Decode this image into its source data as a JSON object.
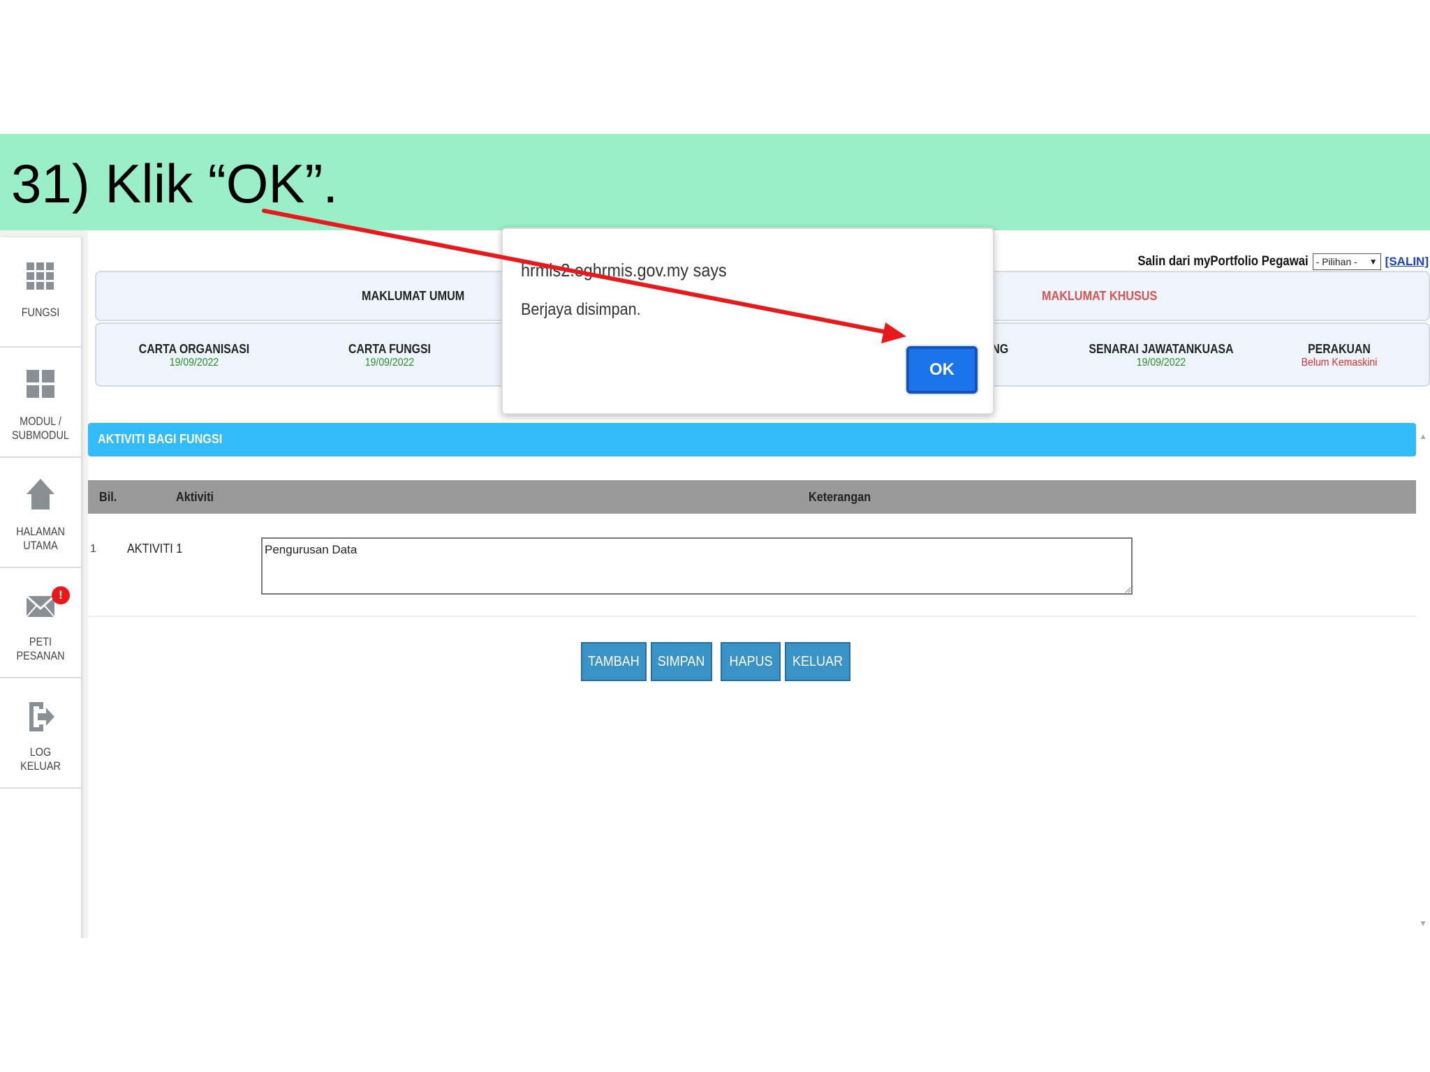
{
  "banner": {
    "instruction": "31) Klik “OK”."
  },
  "sidebar": {
    "items": [
      {
        "label": "FUNGSI",
        "icon": "grid-icon"
      },
      {
        "label": "MODUL /\nSUBMODUL",
        "icon": "modules-icon"
      },
      {
        "label": "HALAMAN\nUTAMA",
        "icon": "home-icon"
      },
      {
        "label": "PETI\nPESANAN",
        "icon": "mail-icon",
        "badge": "!"
      },
      {
        "label": "LOG\nKELUAR",
        "icon": "logout-icon"
      }
    ]
  },
  "copy": {
    "label": "Salin dari myPortfolio Pegawai",
    "select_value": "- Pilihan -",
    "link": "[SALIN]"
  },
  "tabs": {
    "umum": "MAKLUMAT UMUM",
    "khusus": "MAKLUMAT KHUSUS"
  },
  "subtabs": [
    {
      "title": "CARTA ORGANISASI",
      "date": "19/09/2022",
      "status": "ok"
    },
    {
      "title": "CARTA FUNGSI",
      "date": "19/09/2022",
      "status": "ok"
    },
    {
      "title": "NG",
      "date": "",
      "status": "ok"
    },
    {
      "title": "SENARAI JAWATANKUASA",
      "date": "19/09/2022",
      "status": "ok"
    },
    {
      "title": "PERAKUAN",
      "date": "Belum Kemaskini",
      "status": "pending"
    }
  ],
  "section": {
    "title": "AKTIVITI BAGI FUNGSI"
  },
  "table": {
    "headers": {
      "bil": "Bil.",
      "aktiviti": "Aktiviti",
      "keterangan": "Keterangan"
    },
    "rows": [
      {
        "bil": "1",
        "aktiviti": "AKTIVITI 1",
        "keterangan": "Pengurusan Data"
      }
    ]
  },
  "buttons": {
    "tambah": "TAMBAH",
    "simpan": "SIMPAN",
    "hapus": "HAPUS",
    "keluar": "KELUAR"
  },
  "dialog": {
    "origin": "hrmis2.eghrmis.gov.my says",
    "message": "Berjaya disimpan.",
    "ok_label": "OK"
  },
  "colors": {
    "banner": "#9aeec8",
    "section_bar": "#33bbf7",
    "button": "#3a93c7",
    "dialog_ok": "#1a73e8",
    "arrow": "#e8191b"
  }
}
